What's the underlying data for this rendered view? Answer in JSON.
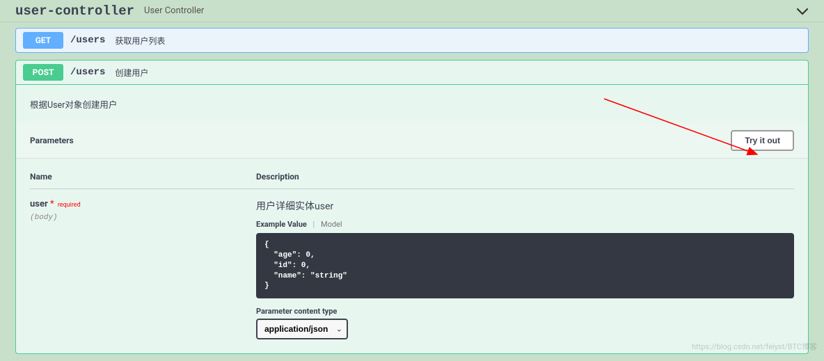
{
  "tag": {
    "name": "user-controller",
    "description": "User Controller"
  },
  "operations": {
    "get": {
      "method": "GET",
      "path": "/users",
      "summary": "获取用户列表"
    },
    "post": {
      "method": "POST",
      "path": "/users",
      "summary": "创建用户",
      "description": "根据User对象创建用户"
    }
  },
  "parameters": {
    "header_label": "Parameters",
    "try_label": "Try it out",
    "name_header": "Name",
    "desc_header": "Description",
    "param": {
      "name": "user",
      "required_label": "required",
      "in": "(body)",
      "description": "用户详细实体user"
    },
    "tabs": {
      "example": "Example Value",
      "model": "Model"
    },
    "example_json": "{\n  \"age\": 0,\n  \"id\": 0,\n  \"name\": \"string\"\n}",
    "content_type": {
      "label": "Parameter content type",
      "value": "application/json"
    }
  },
  "watermark": "https://blog.csdn.net/feiyst/BTC博客"
}
